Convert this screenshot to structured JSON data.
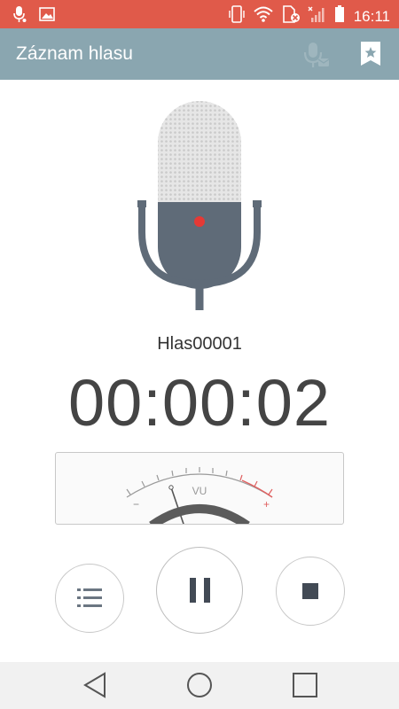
{
  "status_bar": {
    "time": "16:11",
    "background_color": "#e05a4a",
    "left_icons": [
      "mic-notification-icon",
      "image-notification-icon"
    ],
    "right_icons": [
      "phone-vibrate-icon",
      "wifi-icon",
      "sim-error-icon",
      "signal-icon",
      "battery-icon"
    ]
  },
  "app_bar": {
    "title": "Záznam hlasu",
    "background_color": "#8aa6b0",
    "actions": [
      "mic-settings-icon",
      "bookmark-star-icon"
    ]
  },
  "recording": {
    "filename": "Hlas00001",
    "elapsed": "00:00:02",
    "recording_indicator_color": "#e53935"
  },
  "vu_meter": {
    "label": "VU",
    "minus_label": "−",
    "plus_label": "+"
  },
  "controls": {
    "list_icon": "list-icon",
    "pause_icon": "pause-icon",
    "stop_icon": "stop-icon"
  },
  "nav_bar": {
    "icons": [
      "back-icon",
      "home-icon",
      "recents-icon"
    ]
  }
}
